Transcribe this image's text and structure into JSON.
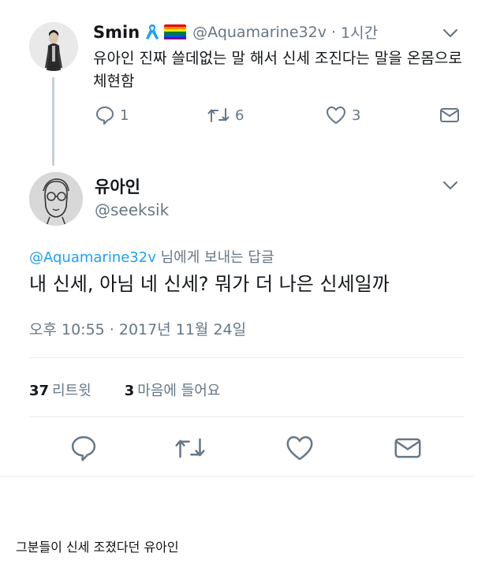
{
  "parent_tweet": {
    "name": "Smin",
    "handle": "@Aquamarine32v",
    "separator": "·",
    "time": "1시간",
    "text": "유아인 진짜 쓸데없는 말 해서 신세 조진다는 말을 온몸으로 체현함",
    "reply_count": "1",
    "retweet_count": "6",
    "like_count": "3",
    "icons": [
      "ribbon-icon",
      "rainbow-flag-icon",
      "chevron-down-icon",
      "reply-icon",
      "retweet-icon",
      "like-icon",
      "message-icon"
    ]
  },
  "main_tweet": {
    "name": "유아인",
    "handle": "@seeksik",
    "reply_mention": "@Aquamarine32v",
    "reply_suffix": "님에게 보내는 답글",
    "text": "내 신세, 아님 네 신세? 뭐가 더 나은 신세일까",
    "date": "오후 10:55 · 2017년 11월 24일",
    "retweets_value": "37",
    "retweets_label": "리트윗",
    "likes_value": "3",
    "likes_label": "마음에 들어요"
  },
  "caption": "그분들이 신세 조졌다던 유아인",
  "colors": {
    "accent": "#1da1f2",
    "secondary_text": "#657786",
    "primary_text": "#14171a",
    "divider": "#e6ecf0",
    "icon": "#657786"
  }
}
